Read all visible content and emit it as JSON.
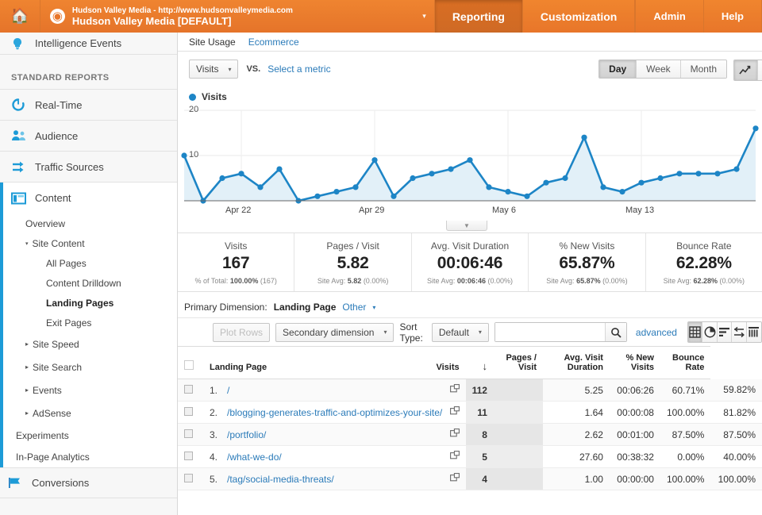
{
  "topbar": {
    "home_icon": "home-icon",
    "globe_icon": "globe-icon",
    "account_url": "Hudson Valley Media - http://www.hudsonvalleymedia.com",
    "account_name": "Hudson Valley Media [DEFAULT]",
    "account_caret": "▾",
    "tabs": [
      {
        "label": "Reporting",
        "active": true
      },
      {
        "label": "Customization",
        "active": false
      }
    ],
    "right_tabs": [
      {
        "label": "Admin"
      },
      {
        "label": "Help"
      }
    ]
  },
  "sidebar": {
    "intelligence": {
      "label": "Intelligence Events",
      "icon": "lightbulb-icon"
    },
    "section_label": "STANDARD REPORTS",
    "items": [
      {
        "label": "Real-Time",
        "icon": "realtime-icon"
      },
      {
        "label": "Audience",
        "icon": "audience-icon"
      },
      {
        "label": "Traffic Sources",
        "icon": "traffic-sources-icon"
      },
      {
        "label": "Content",
        "icon": "content-icon"
      }
    ],
    "content_children": [
      {
        "label": "Overview",
        "type": "leaf",
        "selected": false
      },
      {
        "label": "Site Content",
        "type": "expanded",
        "marker": "▾"
      },
      {
        "label": "All Pages",
        "type": "leaf2",
        "selected": false
      },
      {
        "label": "Content Drilldown",
        "type": "leaf2",
        "selected": false
      },
      {
        "label": "Landing Pages",
        "type": "leaf2",
        "selected": true
      },
      {
        "label": "Exit Pages",
        "type": "leaf2",
        "selected": false
      },
      {
        "label": "Site Speed",
        "type": "collapsed",
        "marker": "▸"
      },
      {
        "label": "Site Search",
        "type": "collapsed",
        "marker": "▸"
      },
      {
        "label": "Events",
        "type": "collapsed",
        "marker": "▸"
      },
      {
        "label": "AdSense",
        "type": "collapsed",
        "marker": "▸"
      },
      {
        "label": "Experiments",
        "type": "leaf",
        "selected": false
      },
      {
        "label": "In-Page Analytics",
        "type": "leaf",
        "selected": false
      }
    ],
    "conversions": {
      "label": "Conversions",
      "icon": "flag-icon"
    }
  },
  "content_tabs": [
    {
      "label": "Site Usage",
      "active": true
    },
    {
      "label": "Ecommerce",
      "active": false
    }
  ],
  "metric_controls": {
    "metric_button": "Visits",
    "caret": "▾",
    "vs_label": "VS.",
    "select_metric": "Select a metric",
    "granularity": [
      {
        "label": "Day",
        "active": true
      },
      {
        "label": "Week",
        "active": false
      },
      {
        "label": "Month",
        "active": false
      }
    ],
    "view_icons": [
      {
        "name": "line-chart-icon",
        "active": true
      },
      {
        "name": "scatter-chart-icon",
        "active": false
      }
    ]
  },
  "legend": {
    "label": "Visits",
    "color": "#1d85c6"
  },
  "chart_data": {
    "type": "line",
    "title": "Visits",
    "xlabel": "",
    "ylabel": "Visits",
    "ylim": [
      0,
      20
    ],
    "yticks": [
      10,
      20
    ],
    "grid": true,
    "legend": [
      "Visits"
    ],
    "legend_position": "top-left",
    "series_color": "#1d85c6",
    "fill_color": "#e2f0f8",
    "tick_labels": [
      "Apr 22",
      "Apr 29",
      "May 6",
      "May 13"
    ],
    "tick_indices": [
      3,
      10,
      17,
      24
    ],
    "x": [
      "Apr 19",
      "Apr 20",
      "Apr 21",
      "Apr 22",
      "Apr 23",
      "Apr 24",
      "Apr 25",
      "Apr 26",
      "Apr 27",
      "Apr 28",
      "Apr 29",
      "Apr 30",
      "May 1",
      "May 2",
      "May 3",
      "May 4",
      "May 5",
      "May 6",
      "May 7",
      "May 8",
      "May 9",
      "May 10",
      "May 11",
      "May 12",
      "May 13",
      "May 14",
      "May 15",
      "May 16",
      "May 17",
      "May 18",
      "May 19"
    ],
    "values": [
      10,
      0,
      5,
      6,
      3,
      7,
      0,
      1,
      2,
      3,
      9,
      1,
      5,
      6,
      7,
      9,
      3,
      2,
      1,
      4,
      5,
      14,
      3,
      2,
      4,
      5,
      6,
      6,
      6,
      7,
      16
    ]
  },
  "summary": [
    {
      "label": "Visits",
      "value": "167",
      "sub_prefix": "% of Total:",
      "sub_bold": "100.00%",
      "sub_suffix": "(167)"
    },
    {
      "label": "Pages / Visit",
      "value": "5.82",
      "sub_prefix": "Site Avg:",
      "sub_bold": "5.82",
      "sub_suffix": "(0.00%)"
    },
    {
      "label": "Avg. Visit Duration",
      "value": "00:06:46",
      "sub_prefix": "Site Avg:",
      "sub_bold": "00:06:46",
      "sub_suffix": "(0.00%)"
    },
    {
      "label": "% New Visits",
      "value": "65.87%",
      "sub_prefix": "Site Avg:",
      "sub_bold": "65.87%",
      "sub_suffix": "(0.00%)"
    },
    {
      "label": "Bounce Rate",
      "value": "62.28%",
      "sub_prefix": "Site Avg:",
      "sub_bold": "62.28%",
      "sub_suffix": "(0.00%)"
    }
  ],
  "primary_dimension": {
    "label": "Primary Dimension:",
    "value": "Landing Page",
    "other": "Other",
    "other_caret": "▾"
  },
  "table_toolbar": {
    "plot_rows": "Plot Rows",
    "secondary_dimension": "Secondary dimension",
    "secondary_caret": "▾",
    "sort_type_label": "Sort Type:",
    "sort_type_value": "Default",
    "sort_caret": "▾",
    "search_value": "",
    "search_placeholder": "",
    "search_icon": "search-icon",
    "advanced": "advanced",
    "view_buttons": [
      {
        "name": "table-view-icon",
        "active": true
      },
      {
        "name": "pie-view-icon",
        "active": false
      },
      {
        "name": "bar-view-icon",
        "active": false
      },
      {
        "name": "comparison-view-icon",
        "active": false
      },
      {
        "name": "pivot-view-icon",
        "active": false
      }
    ]
  },
  "table": {
    "columns": [
      "Landing Page",
      "Visits",
      "Pages / Visit",
      "Avg. Visit Duration",
      "% New Visits",
      "Bounce Rate"
    ],
    "sort_arrow": "↓",
    "rows": [
      {
        "index": "1.",
        "page": "/",
        "visits": "112",
        "pages_visit": "5.25",
        "duration": "00:06:26",
        "new_visits": "60.71%",
        "bounce": "59.82%"
      },
      {
        "index": "2.",
        "page": "/blogging-generates-traffic-and-optimizes-your-site/",
        "visits": "11",
        "pages_visit": "1.64",
        "duration": "00:00:08",
        "new_visits": "100.00%",
        "bounce": "81.82%"
      },
      {
        "index": "3.",
        "page": "/portfolio/",
        "visits": "8",
        "pages_visit": "2.62",
        "duration": "00:01:00",
        "new_visits": "87.50%",
        "bounce": "87.50%"
      },
      {
        "index": "4.",
        "page": "/what-we-do/",
        "visits": "5",
        "pages_visit": "27.60",
        "duration": "00:38:32",
        "new_visits": "0.00%",
        "bounce": "40.00%"
      },
      {
        "index": "5.",
        "page": "/tag/social-media-threats/",
        "visits": "4",
        "pages_visit": "1.00",
        "duration": "00:00:00",
        "new_visits": "100.00%",
        "bounce": "100.00%"
      }
    ]
  }
}
